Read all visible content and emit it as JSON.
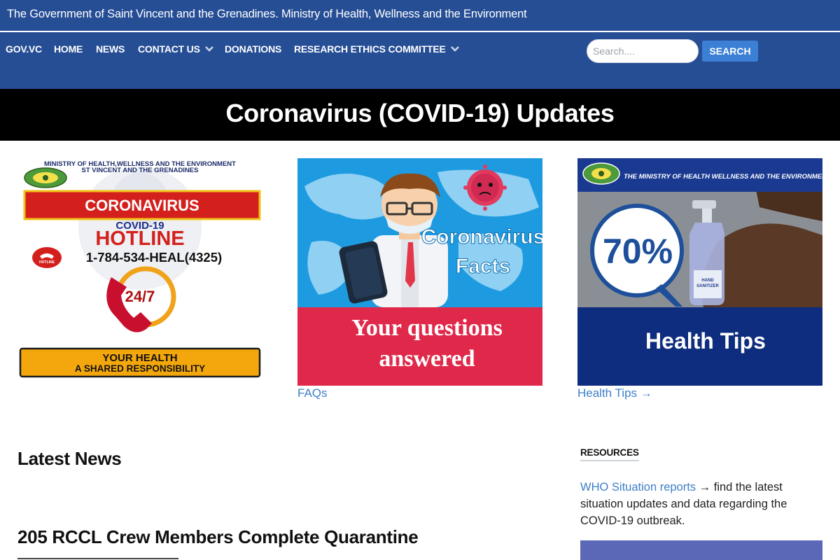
{
  "header": {
    "title": "The Government of Saint Vincent and the Grenadines. Ministry of Health, Wellness and the Environment"
  },
  "nav": {
    "items": [
      {
        "label": "GOV.VC",
        "has_dropdown": false
      },
      {
        "label": "HOME",
        "has_dropdown": false
      },
      {
        "label": "NEWS",
        "has_dropdown": false
      },
      {
        "label": "CONTACT US",
        "has_dropdown": true
      },
      {
        "label": "DONATIONS",
        "has_dropdown": false
      },
      {
        "label": "RESEARCH ETHICS COMMITTEE",
        "has_dropdown": true
      }
    ]
  },
  "search": {
    "placeholder": "Search....",
    "value": "",
    "button_label": "SEARCH"
  },
  "banner": {
    "heading": "Coronavirus (COVID-19) Updates"
  },
  "cards": [
    {
      "name": "hotline",
      "ministry_line1": "MINISTRY OF HEALTH,WELLNESS AND THE ENVIRONMENT",
      "ministry_line2": "ST VINCENT AND THE GRENADINES",
      "coronavirus": "CORONAVIRUS",
      "covid": "COVID-19",
      "hotline": "HOTLINE",
      "phone": "1-784-534-HEAL(4325)",
      "phone_badge": "HOTLINE",
      "hours": "24/7",
      "slogan_line1": "YOUR HEALTH",
      "slogan_line2": "A SHARED RESPONSIBILITY"
    },
    {
      "name": "faqs",
      "image_line1": "Coronavirus",
      "image_line2": "Facts",
      "caption_line1": "Your questions",
      "caption_line2": "answered",
      "link": "FAQs"
    },
    {
      "name": "health-tips",
      "ministry": "THE MINISTRY OF HEALTH WELLNESS AND THE ENVIRONMENT",
      "percent": "70%",
      "label_hand": "HAND",
      "label_sanitizer": "SANITIZER",
      "caption": "Health Tips",
      "link": "Health Tips →"
    }
  ],
  "latest_news": {
    "heading": "Latest News",
    "articles": [
      {
        "title": "205 RCCL Crew Members Complete Quarantine"
      }
    ]
  },
  "resources": {
    "heading": "RESOURCES",
    "link": "WHO Situation reports",
    "text": " → find the latest situation updates and data regarding the COVID-19 outbreak."
  },
  "colors": {
    "header_blue": "#264e95",
    "banner_black": "#000000",
    "link_blue": "#3d7fc9",
    "button_blue": "#3c80d6",
    "faq_caption_red": "#e0294a",
    "tips_caption_navy": "#0e2d7e"
  }
}
